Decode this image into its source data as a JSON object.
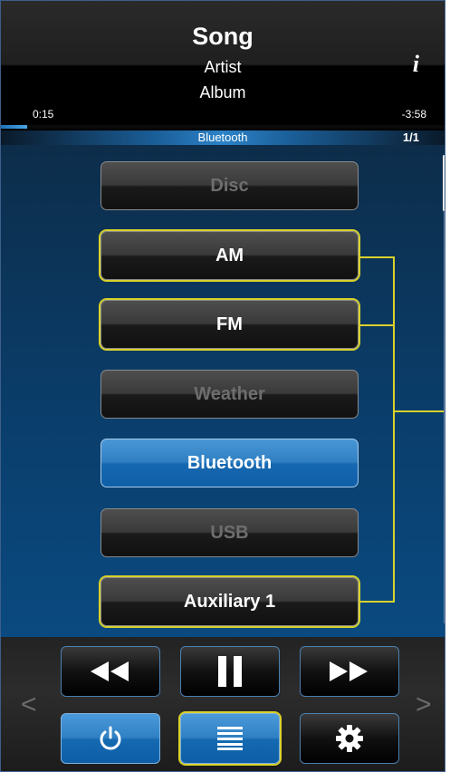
{
  "header": {
    "song": "Song",
    "artist": "Artist",
    "album": "Album",
    "info_label": "i",
    "time_elapsed": "0:15",
    "time_remaining": "-3:58",
    "progress_fraction": 0.06
  },
  "source_bar": {
    "current_source": "Bluetooth",
    "page_indicator": "1/1"
  },
  "sources": [
    {
      "label": "Disc",
      "state": "disabled",
      "favorite": false
    },
    {
      "label": "AM",
      "state": "enabled",
      "favorite": true
    },
    {
      "label": "FM",
      "state": "enabled",
      "favorite": true
    },
    {
      "label": "Weather",
      "state": "disabled",
      "favorite": false
    },
    {
      "label": "Bluetooth",
      "state": "selected",
      "favorite": false
    },
    {
      "label": "USB",
      "state": "disabled",
      "favorite": false
    },
    {
      "label": "Auxiliary 1",
      "state": "enabled",
      "favorite": true
    }
  ],
  "controls": {
    "prev_arrow": "<",
    "next_arrow": ">",
    "transport": [
      "rewind-icon",
      "pause-icon",
      "fast-forward-icon"
    ],
    "bottom": [
      "power-icon",
      "list-icon",
      "gear-icon"
    ]
  },
  "colors": {
    "accent_blue": "#2f81c4",
    "favorite_highlight": "#d9d22a",
    "disabled_text": "#6e6e6e"
  }
}
